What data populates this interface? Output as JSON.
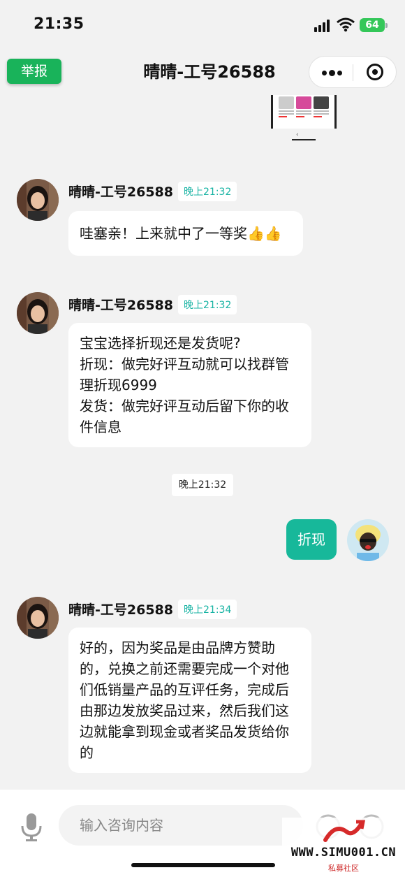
{
  "status": {
    "time": "21:35",
    "battery": "64"
  },
  "header": {
    "report": "举报",
    "title": "晴晴-工号26588"
  },
  "messages": [
    {
      "sender": "晴晴-工号26588",
      "time": "晚上21:32",
      "text": "哇塞亲！上来就中了一等奖👍👍"
    },
    {
      "sender": "晴晴-工号26588",
      "time": "晚上21:32",
      "lines": [
        "宝宝选择折现还是发货呢?",
        "折现：做完好评互动就可以找群管",
        "理折现6999",
        "发货：做完好评互动后留下你的收",
        "件信息"
      ]
    },
    {
      "center_time": "晚上21:32"
    },
    {
      "mine": "折现"
    },
    {
      "sender": "晴晴-工号26588",
      "time": "晚上21:34",
      "lines": [
        "好的，因为奖品是由品牌方赞助",
        "的，兑换之前还需要完成一个对他",
        "们低销量产品的互评任务，完成后",
        "由那边发放奖品过来，然后我们这",
        "边就能拿到现金或者奖品发货给你",
        "的"
      ]
    }
  ],
  "input": {
    "placeholder": "输入咨询内容"
  },
  "watermark": {
    "site": "WWW.SIMU001.CN",
    "sub": "私募社区"
  },
  "colors": {
    "accent": "#17b89a",
    "report": "#19b35a",
    "time_tag": "#17b3a3"
  }
}
